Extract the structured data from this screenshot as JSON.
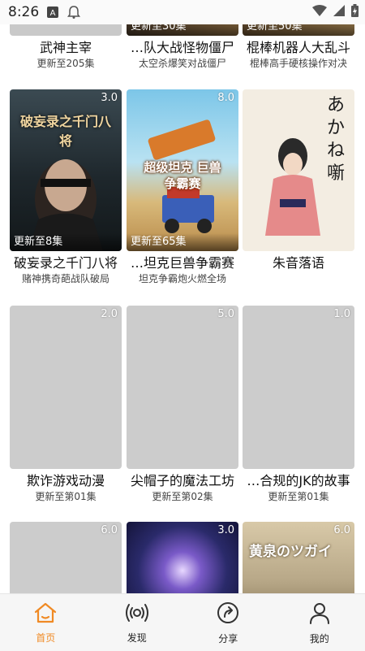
{
  "status_bar": {
    "time": "8:26"
  },
  "row1": [
    {
      "title": "武神主宰",
      "subtitle": "更新至205集",
      "update": "",
      "score": ""
    },
    {
      "title": "…队大战怪物僵尸",
      "subtitle": "太空杀爆笑对战僵尸",
      "update": "更新至30集",
      "score": ""
    },
    {
      "title": "棍棒机器人大乱斗",
      "subtitle": "棍棒高手硬核操作对决",
      "update": "更新至50集",
      "score": ""
    }
  ],
  "row2": [
    {
      "title": "破妄录之千门八将",
      "subtitle": "赌神携奇葩战队破局",
      "update": "更新至8集",
      "score": "3.0",
      "poster_text": "破妄录之千门八将"
    },
    {
      "title": "…坦克巨兽争霸赛",
      "subtitle": "坦克争霸炮火燃全场",
      "update": "更新至65集",
      "score": "8.0",
      "poster_text": "超级坦克 巨兽争霸赛"
    },
    {
      "title": "朱音落语",
      "subtitle": "",
      "update": "",
      "score": "",
      "poster_text": "あかね噺"
    }
  ],
  "row3": [
    {
      "title": "欺诈游戏动漫",
      "subtitle": "更新至第01集",
      "score": "2.0"
    },
    {
      "title": "尖帽子的魔法工坊",
      "subtitle": "更新至第02集",
      "score": "5.0"
    },
    {
      "title": "…合规的JK的故事",
      "subtitle": "更新至第01集",
      "score": "1.0"
    }
  ],
  "row4": [
    {
      "score": "6.0"
    },
    {
      "score": "3.0"
    },
    {
      "score": "6.0",
      "poster_text": "黄泉のツガイ"
    }
  ],
  "tabs": [
    {
      "label": "首页",
      "icon": "home-icon",
      "active": true
    },
    {
      "label": "发现",
      "icon": "broadcast-icon",
      "active": false
    },
    {
      "label": "分享",
      "icon": "share-icon",
      "active": false
    },
    {
      "label": "我的",
      "icon": "profile-icon",
      "active": false
    }
  ],
  "colors": {
    "accent": "#f08a24",
    "placeholder": "#cccccc"
  }
}
